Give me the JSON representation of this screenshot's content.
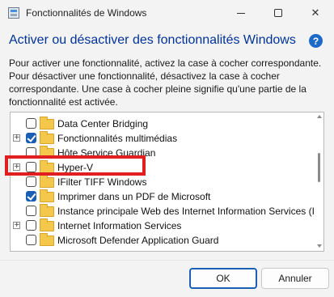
{
  "window": {
    "title": "Fonctionnalités de Windows",
    "icon": "windows-features-icon"
  },
  "heading": "Activer ou désactiver des fonctionnalités Windows",
  "help_icon": {
    "name": "help-icon",
    "glyph": "?",
    "color": "#1c6ac7"
  },
  "description": [
    "Pour activer une fonctionnalité, activez la case à cocher correspondante.",
    "Pour désactiver une fonctionnalité, désactivez la case à cocher",
    "correspondante. Une case à cocher pleine signifie qu'une partie de la",
    "fonctionnalité est activée."
  ],
  "features": [
    {
      "label": "Data Center Bridging",
      "checked": false,
      "expandable": false
    },
    {
      "label": "Fonctionnalités multimédias",
      "checked": true,
      "expandable": true
    },
    {
      "label": "Hôte Service Guardian",
      "checked": false,
      "expandable": false
    },
    {
      "label": "Hyper-V",
      "checked": false,
      "expandable": true
    },
    {
      "label": "IFilter TIFF Windows",
      "checked": false,
      "expandable": false
    },
    {
      "label": "Imprimer dans un PDF de Microsoft",
      "checked": true,
      "expandable": false
    },
    {
      "label": "Instance principale Web des Internet Information Services (IIS",
      "checked": false,
      "expandable": false
    },
    {
      "label": "Internet Information Services",
      "checked": false,
      "expandable": true
    },
    {
      "label": "Microsoft Defender Application Guard",
      "checked": false,
      "expandable": false
    }
  ],
  "highlight_color": "#e02020",
  "accent_color": "#1a5fb4",
  "heading_color": "#003399",
  "buttons": {
    "ok": "OK",
    "cancel": "Annuler"
  },
  "expander_glyph": "+"
}
